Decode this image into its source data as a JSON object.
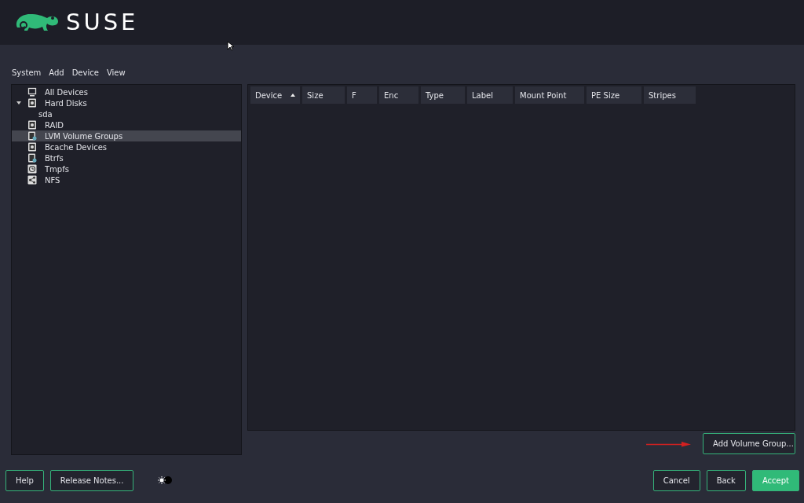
{
  "header": {
    "logo_text": "SUSE"
  },
  "menu": [
    {
      "label": "System"
    },
    {
      "label": "Add"
    },
    {
      "label": "Device"
    },
    {
      "label": "View"
    }
  ],
  "tree": [
    {
      "label": "All Devices",
      "kind": "monitor",
      "selected": false
    },
    {
      "label": "Hard Disks",
      "kind": "disk",
      "selected": false,
      "expanded": true,
      "children": [
        {
          "label": "sda",
          "selected": false
        }
      ]
    },
    {
      "label": "RAID",
      "kind": "disk",
      "selected": false
    },
    {
      "label": "LVM Volume Groups",
      "kind": "lvm",
      "selected": true
    },
    {
      "label": "Bcache Devices",
      "kind": "disk",
      "selected": false
    },
    {
      "label": "Btrfs",
      "kind": "lvm",
      "selected": false
    },
    {
      "label": "Tmpfs",
      "kind": "clock",
      "selected": false
    },
    {
      "label": "NFS",
      "kind": "share",
      "selected": false
    }
  ],
  "table": {
    "columns": [
      {
        "label": "Device",
        "sorted": true
      },
      {
        "label": "Size",
        "sorted": false
      },
      {
        "label": "F",
        "sorted": false
      },
      {
        "label": "Enc",
        "sorted": false
      },
      {
        "label": "Type",
        "sorted": false
      },
      {
        "label": "Label",
        "sorted": false
      },
      {
        "label": "Mount Point",
        "sorted": false
      },
      {
        "label": "PE Size",
        "sorted": false
      },
      {
        "label": "Stripes",
        "sorted": false
      }
    ]
  },
  "action_button": {
    "label": "Add Volume Group..."
  },
  "footer": {
    "left_buttons": [
      {
        "label": "Help"
      },
      {
        "label": "Release Notes..."
      }
    ],
    "right_buttons": [
      {
        "label": "Cancel",
        "primary": false
      },
      {
        "label": "Back",
        "primary": false
      },
      {
        "label": "Accept",
        "primary": true
      }
    ]
  }
}
